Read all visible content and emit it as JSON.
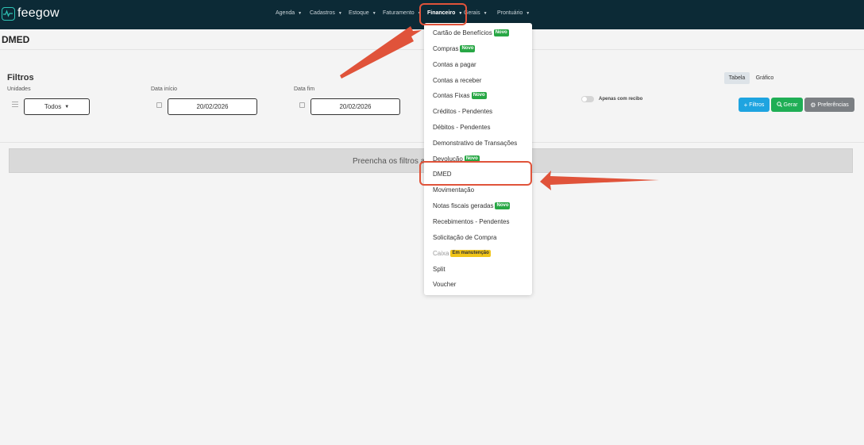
{
  "header": {
    "logo_text": "feegow",
    "nav": [
      {
        "label": "Agenda"
      },
      {
        "label": "Cadastros"
      },
      {
        "label": "Estoque"
      },
      {
        "label": "Faturamento"
      },
      {
        "label": "Financeiro"
      },
      {
        "label": "Gerais"
      },
      {
        "label": "Prontuário"
      }
    ]
  },
  "page": {
    "title": "DMED"
  },
  "filters": {
    "title": "Filtros",
    "unidades_label": "Unidades",
    "unidades_value": "Todos",
    "data_inicio_label": "Data início",
    "data_inicio_value": "20/02/2026",
    "data_fim_label": "Data fim",
    "data_fim_value": "20/02/2026",
    "apenas_recibo_label": "Apenas com recibo",
    "apenas_recibo_on": false,
    "view_tabs": [
      {
        "label": "Tabela",
        "active": true
      },
      {
        "label": "Gráfico",
        "active": false
      }
    ],
    "buttons": {
      "filtros": "Filtros",
      "gerar": "Gerar",
      "preferencias": "Preferências"
    }
  },
  "info_message": "Preencha os filtros a",
  "financeiro_menu": {
    "items": [
      {
        "label": "Cartão de Benefícios",
        "badge": "Novo"
      },
      {
        "label": "Compras",
        "badge": "Novo"
      },
      {
        "label": "Contas a pagar"
      },
      {
        "label": "Contas a receber"
      },
      {
        "label": "Contas Fixas",
        "badge": "Novo"
      },
      {
        "label": "Créditos - Pendentes"
      },
      {
        "label": "Débitos - Pendentes"
      },
      {
        "label": "Demonstrativo de Transações"
      },
      {
        "label": "Devolução",
        "badge": "Novo"
      },
      {
        "label": "DMED"
      },
      {
        "label": "Movimentação"
      },
      {
        "label": "Notas fiscais geradas",
        "badge": "Novo"
      },
      {
        "label": "Recebimentos - Pendentes"
      },
      {
        "label": "Solicitação de Compra"
      },
      {
        "label": "Caixa",
        "badge": "Em manutenção",
        "muted": true
      },
      {
        "label": "Split"
      },
      {
        "label": "Voucher"
      }
    ]
  },
  "colors": {
    "topbar": "#0c2a36",
    "accent_teal": "#2ec4b6",
    "annotation": "#e0533a",
    "badge_new": "#28a745",
    "badge_maintenance": "#f0c419",
    "btn_filtros": "#1ea4e0",
    "btn_gerar": "#1fae55",
    "btn_pref": "#7b7f83"
  },
  "icons": [
    "heartbeat-logo-icon",
    "list-icon",
    "calendar-icon",
    "plus-icon",
    "search-icon",
    "gear-icon",
    "caret-down-icon"
  ]
}
